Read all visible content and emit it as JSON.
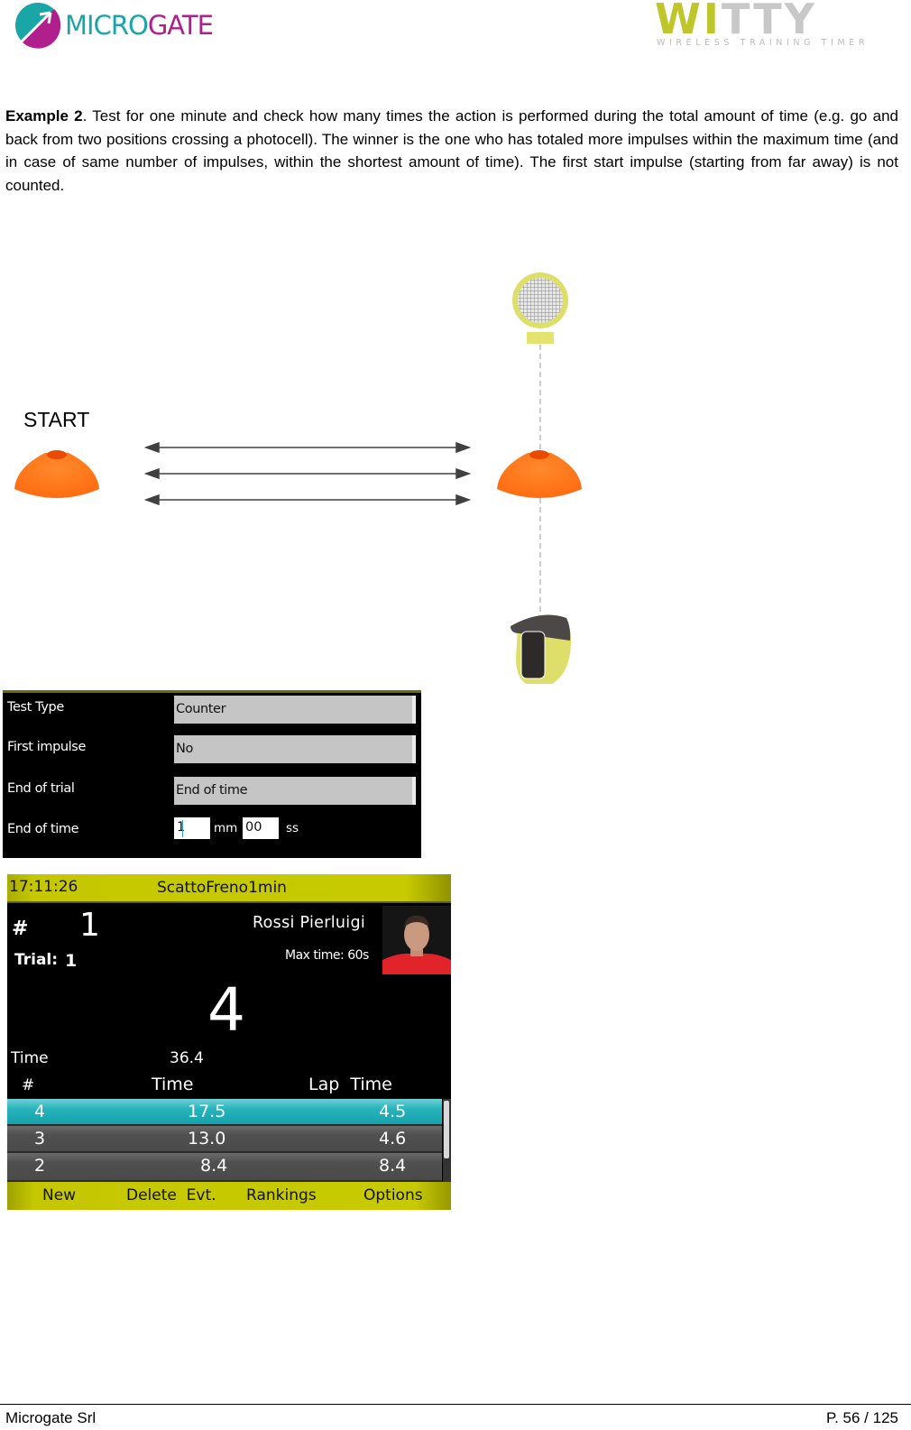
{
  "header": {
    "left_logo": {
      "icon": "microgate-logo-icon",
      "text_part1": "MICRO",
      "text_part2": "GATE"
    },
    "right_logo": {
      "word_part1": "WI",
      "word_part2": "TTY",
      "subtitle": "WIRELESS TRAINING TIMER"
    }
  },
  "paragraph": {
    "bold_lead": "Example 2",
    "text": ". Test for one minute and check how many times the action is performed during the total amount of time (e.g. go and back from two positions crossing a photocell). The winner is the one who has totaled more impulses within the maximum time (and in case of same number of impulses, within the shortest amount of time). The first start impulse (starting from far away) is not counted."
  },
  "diagram": {
    "start_label": "START",
    "arrows_count": 3,
    "elements": [
      "photocell-reflector-icon",
      "cone-start-icon",
      "cone-end-icon",
      "photocell-transmitter-icon"
    ]
  },
  "settings_panel": {
    "rows": [
      {
        "label": "Test Type",
        "value": "Counter"
      },
      {
        "label": "First impulse",
        "value": "No"
      },
      {
        "label": "End of trial",
        "value": "End of time"
      }
    ],
    "end_of_time": {
      "label": "End of time",
      "minutes": "1",
      "minutes_unit": "mm",
      "seconds": "00",
      "seconds_unit": "ss"
    }
  },
  "device_screen": {
    "clock": "17:11:26",
    "title": "ScattoFreno1min",
    "hash_label": "#",
    "athlete_number": "1",
    "trial_label": "Trial:",
    "trial_value": "1",
    "athlete_name": "Rossi  Pierluigi",
    "max_time": "Max time: 60s",
    "count": "4",
    "time_label": "Time",
    "time_value": "36.4",
    "columns": [
      "#",
      "Time",
      "Lap  Time"
    ],
    "rows": [
      {
        "num": "4",
        "time": "17.5",
        "lap": "4.5",
        "highlighted": true
      },
      {
        "num": "3",
        "time": "13.0",
        "lap": "4.6",
        "highlighted": false
      },
      {
        "num": "2",
        "time": "8.4",
        "lap": "8.4",
        "highlighted": false
      }
    ],
    "buttons": [
      "New",
      "Delete  Evt.",
      "Rankings",
      "Options"
    ],
    "colors": {
      "bar": "#c7ca00",
      "highlight": "#27b3bc",
      "row": "#505050"
    }
  },
  "footer": {
    "company": "Microgate Srl",
    "page": "P. 56 / 125"
  }
}
